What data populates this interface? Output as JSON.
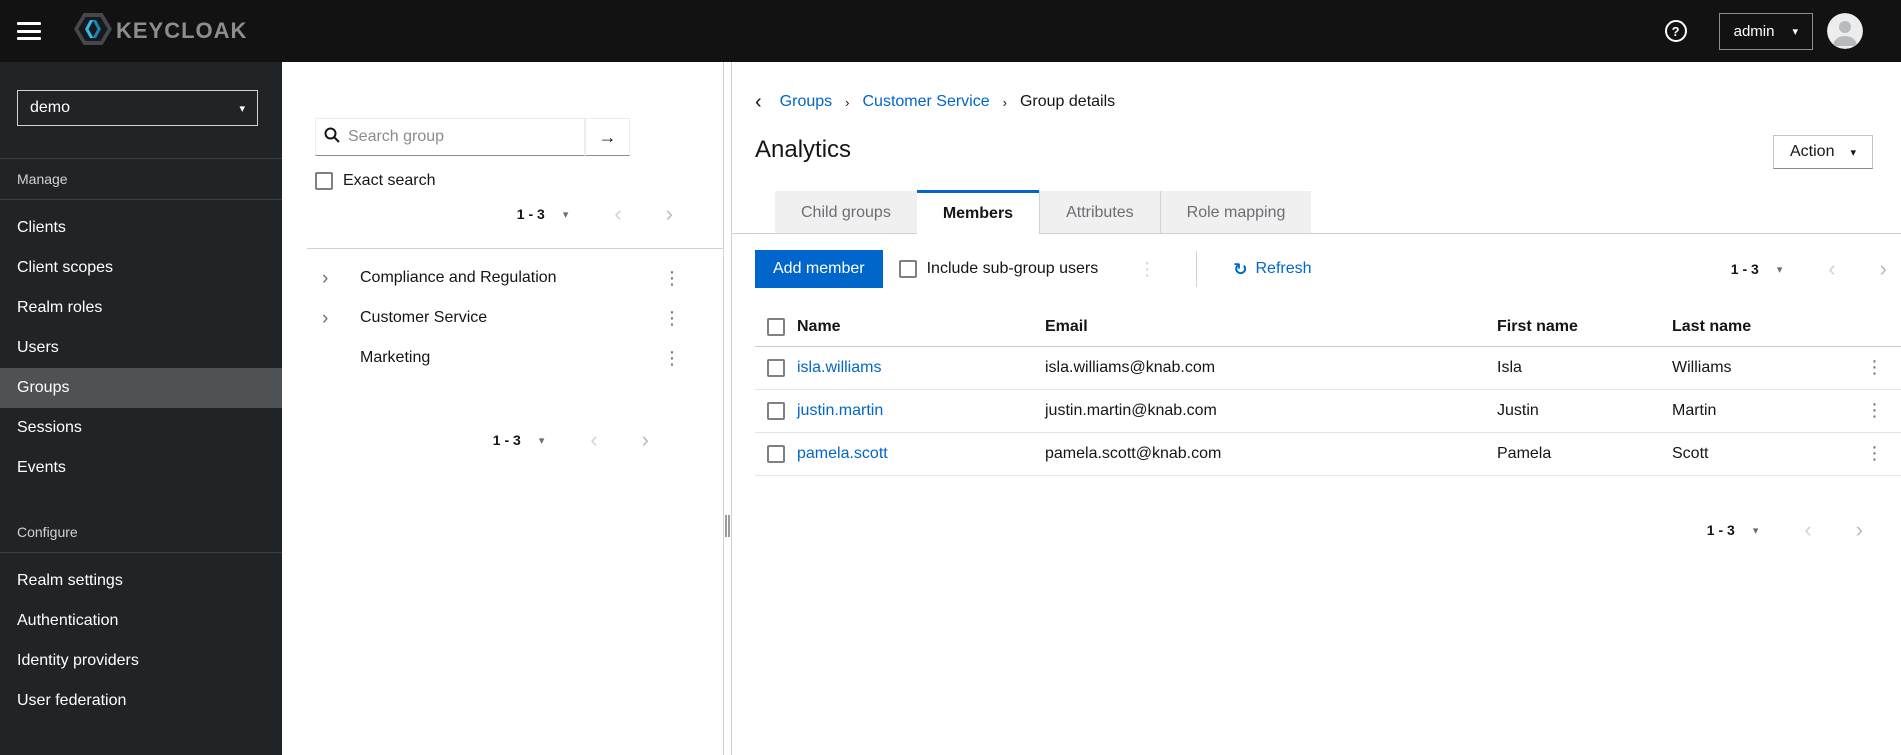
{
  "masthead": {
    "brand_text": "KEYCLOAK",
    "user_menu_label": "admin"
  },
  "glyphs": {
    "caret_down": "▾",
    "back_chevron": "‹",
    "breadcrumb_separator": "›",
    "tree_expand_chevron": "›",
    "prev_page": "‹",
    "next_page": "›",
    "kebab": "⋮",
    "search_submit_arrow": "→",
    "refresh": "↻",
    "help": "?"
  },
  "realm_selector": {
    "current_realm": "demo"
  },
  "sidebar": {
    "sections": [
      {
        "title": "Manage",
        "items": [
          {
            "label": "Clients",
            "active": false
          },
          {
            "label": "Client scopes",
            "active": false
          },
          {
            "label": "Realm roles",
            "active": false
          },
          {
            "label": "Users",
            "active": false
          },
          {
            "label": "Groups",
            "active": true
          },
          {
            "label": "Sessions",
            "active": false
          },
          {
            "label": "Events",
            "active": false
          }
        ]
      },
      {
        "title": "Configure",
        "items": [
          {
            "label": "Realm settings",
            "active": false
          },
          {
            "label": "Authentication",
            "active": false
          },
          {
            "label": "Identity providers",
            "active": false
          },
          {
            "label": "User federation",
            "active": false
          }
        ]
      }
    ]
  },
  "group_panel": {
    "search_placeholder": "Search group",
    "exact_search_label": "Exact search",
    "pagination_top": {
      "range": "1 - 3"
    },
    "tree_items": [
      {
        "label": "Compliance and Regulation",
        "has_children": true
      },
      {
        "label": "Customer Service",
        "has_children": true
      },
      {
        "label": "Marketing",
        "has_children": false
      }
    ],
    "pagination_bottom": {
      "range": "1 - 3"
    }
  },
  "main": {
    "breadcrumb": {
      "items": [
        {
          "label": "Groups",
          "is_link": true
        },
        {
          "label": "Customer Service",
          "is_link": true
        },
        {
          "label": "Group details",
          "is_link": false
        }
      ]
    },
    "page_title": "Analytics",
    "action_button_label": "Action",
    "tabs": [
      {
        "label": "Child groups",
        "active": false
      },
      {
        "label": "Members",
        "active": true
      },
      {
        "label": "Attributes",
        "active": false
      },
      {
        "label": "Role mapping",
        "active": false
      }
    ],
    "members_toolbar": {
      "add_member_label": "Add member",
      "include_subgroups_label": "Include sub-group users",
      "refresh_label": "Refresh",
      "pagination": {
        "range": "1 - 3"
      }
    },
    "members_table": {
      "columns": [
        "Name",
        "Email",
        "First name",
        "Last name"
      ],
      "rows": [
        {
          "name": "isla.williams",
          "email": "isla.williams@knab.com",
          "first_name": "Isla",
          "last_name": "Williams"
        },
        {
          "name": "justin.martin",
          "email": "justin.martin@knab.com",
          "first_name": "Justin",
          "last_name": "Martin"
        },
        {
          "name": "pamela.scott",
          "email": "pamela.scott@knab.com",
          "first_name": "Pamela",
          "last_name": "Scott"
        }
      ]
    },
    "pagination_bottom": {
      "range": "1 - 3"
    }
  },
  "colors": {
    "primary_blue": "#0066cc",
    "link_blue": "#0066cc",
    "masthead_bg": "#121212",
    "sidebar_bg": "#212427",
    "sidebar_active_bg": "#4f5255",
    "inactive_tab_bg": "#f0f0f0",
    "border_gray": "#d2d2d2"
  }
}
